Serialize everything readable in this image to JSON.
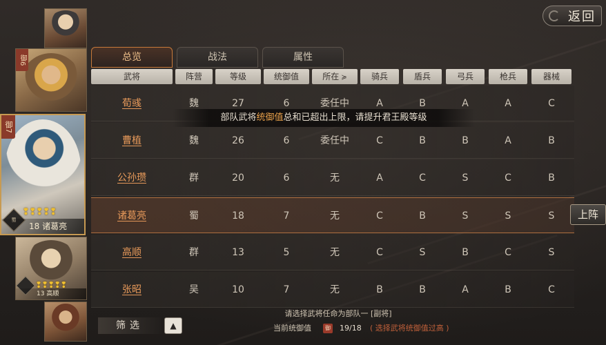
{
  "return_button": {
    "label": "返回"
  },
  "tabs": [
    {
      "label": "总览",
      "active": true
    },
    {
      "label": "战法",
      "active": false
    },
    {
      "label": "属性",
      "active": false
    }
  ],
  "columns": [
    "武将",
    "阵营",
    "等级",
    "统御值",
    "所在",
    "骑兵",
    "盾兵",
    "弓兵",
    "枪兵",
    "器械"
  ],
  "rows": [
    {
      "name": "荀彧",
      "faction": "魏",
      "level": "27",
      "command": "6",
      "location": "委任中",
      "cavalry": "A",
      "shield": "B",
      "archer": "A",
      "spear": "A",
      "siege": "C"
    },
    {
      "name": "曹植",
      "faction": "魏",
      "level": "26",
      "command": "6",
      "location": "委任中",
      "cavalry": "C",
      "shield": "B",
      "archer": "B",
      "spear": "A",
      "siege": "B"
    },
    {
      "name": "公孙瓒",
      "faction": "群",
      "level": "20",
      "command": "6",
      "location": "无",
      "cavalry": "A",
      "shield": "C",
      "archer": "S",
      "spear": "C",
      "siege": "B"
    },
    {
      "name": "诸葛亮",
      "faction": "蜀",
      "level": "18",
      "command": "7",
      "location": "无",
      "cavalry": "C",
      "shield": "B",
      "archer": "S",
      "spear": "S",
      "siege": "S"
    },
    {
      "name": "高顺",
      "faction": "群",
      "level": "13",
      "command": "5",
      "location": "无",
      "cavalry": "C",
      "shield": "S",
      "archer": "B",
      "spear": "C",
      "siege": "S"
    },
    {
      "name": "张昭",
      "faction": "吴",
      "level": "10",
      "command": "7",
      "location": "无",
      "cavalry": "B",
      "shield": "B",
      "archer": "A",
      "spear": "B",
      "siege": "C"
    }
  ],
  "toast": {
    "part1": "部队武将",
    "highlight": "统御值",
    "part2": "总和已超出上限，请提升君王殿等级"
  },
  "deploy_button": {
    "label": "上阵"
  },
  "portraits": {
    "card2": {
      "tag": "御6"
    },
    "card3": {
      "tag": "御7",
      "stars": "❢❢❢❢❢",
      "caption": "18 诸葛亮",
      "seal": "蜀"
    },
    "card4": {
      "stars": "❢❢❢❢❢",
      "caption": "13 高顺"
    }
  },
  "filter": {
    "label": "筛选",
    "button": "▲"
  },
  "hint": {
    "line1": "请选择武将任命为部队一 [副将]",
    "current_label": "当前统御值",
    "badge": "御",
    "current_value": "19/18",
    "warning": "( 选择武将统御值过高 )"
  },
  "colors": {
    "accent": "#e89a5a",
    "highlight": "#e8a04a",
    "warning": "#c0603a"
  }
}
